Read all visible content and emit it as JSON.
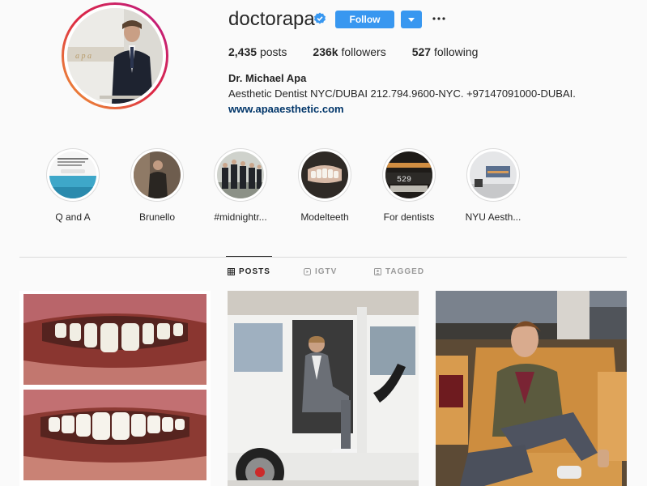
{
  "profile": {
    "username": "doctorapa",
    "follow_label": "Follow",
    "stats": {
      "posts_count": "2,435",
      "posts_label": "posts",
      "followers_count": "236k",
      "followers_label": "followers",
      "following_count": "527",
      "following_label": "following"
    },
    "full_name": "Dr. Michael Apa",
    "bio": "Aesthetic Dentist NYC/DUBAI 212.794.9600-NYC. +97147091000-DUBAI.",
    "website": "www.apaaesthetic.com"
  },
  "highlights": [
    {
      "label": "Q and A"
    },
    {
      "label": "Brunello"
    },
    {
      "label": "#midnightr..."
    },
    {
      "label": "Modelteeth"
    },
    {
      "label": "For dentists"
    },
    {
      "label": "NYU Aesth..."
    }
  ],
  "tabs": [
    {
      "label": "POSTS",
      "active": true
    },
    {
      "label": "IGTV",
      "active": false
    },
    {
      "label": "TAGGED",
      "active": false
    }
  ],
  "colors": {
    "accent": "#3897f0",
    "link": "#003569",
    "verified": "#3897f0"
  }
}
